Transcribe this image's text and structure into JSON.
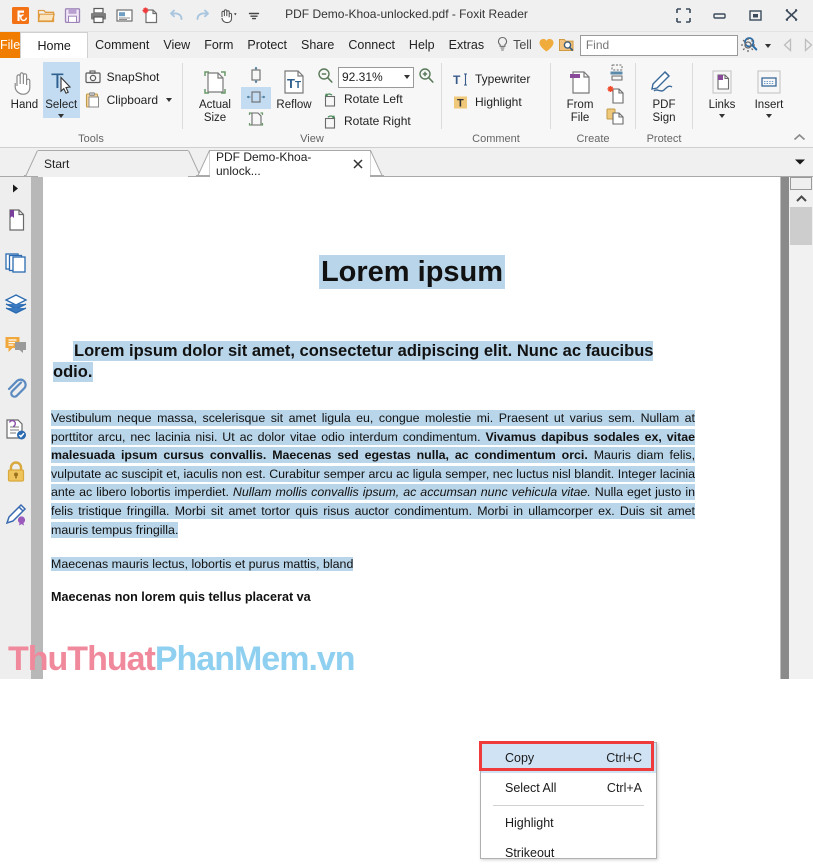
{
  "window": {
    "title": "PDF Demo-Khoa-unlocked.pdf - Foxit Reader",
    "quick_access": [
      {
        "name": "foxit-logo-icon",
        "label": "Foxit"
      },
      {
        "name": "open-icon",
        "label": "Open"
      },
      {
        "name": "save-icon",
        "label": "Save"
      },
      {
        "name": "print-icon",
        "label": "Print"
      },
      {
        "name": "email-icon",
        "label": "Email"
      },
      {
        "name": "new-blank-icon",
        "label": "New"
      },
      {
        "name": "undo-icon",
        "label": "Undo"
      },
      {
        "name": "redo-icon",
        "label": "Redo"
      },
      {
        "name": "hand-tool-icon",
        "label": "Hand Tool"
      },
      {
        "name": "customize-toolbar-icon",
        "label": "Customize"
      }
    ],
    "controls": [
      {
        "name": "fullscreen-icon",
        "label": "Full Screen"
      },
      {
        "name": "minimize-icon",
        "label": "Minimize"
      },
      {
        "name": "maximize-icon",
        "label": "Restore"
      },
      {
        "name": "close-icon",
        "label": "Close"
      }
    ]
  },
  "menubar": {
    "file_label": "File",
    "items": [
      {
        "label": "Home",
        "active": true
      },
      {
        "label": "Comment",
        "active": false
      },
      {
        "label": "View",
        "active": false
      },
      {
        "label": "Form",
        "active": false
      },
      {
        "label": "Protect",
        "active": false
      },
      {
        "label": "Share",
        "active": false
      },
      {
        "label": "Connect",
        "active": false
      },
      {
        "label": "Help",
        "active": false
      },
      {
        "label": "Extras",
        "active": false
      }
    ],
    "tell_label": "Tell",
    "search": {
      "value": "",
      "placeholder": "Find"
    }
  },
  "ribbon": {
    "groups": [
      {
        "name": "Tools",
        "label": "Tools",
        "buttons": [
          {
            "label": "Hand",
            "icon": "hand-icon",
            "active": false
          },
          {
            "label": "Select",
            "icon": "select-text-icon",
            "active": true
          },
          {
            "label": "SnapShot",
            "icon": "snapshot-camera-icon"
          },
          {
            "label": "Clipboard",
            "icon": "clipboard-icon"
          }
        ]
      },
      {
        "name": "View",
        "label": "View",
        "buttons": [
          {
            "label": "Actual Size",
            "icon": "actual-size-icon"
          },
          {
            "label": "Fit Page",
            "icon": "fit-page-icon"
          },
          {
            "label": "Fit Width",
            "icon": "fit-width-icon"
          },
          {
            "label": "Fit Visible",
            "icon": "fit-visible-icon"
          },
          {
            "label": "Reflow",
            "icon": "reflow-icon"
          },
          {
            "label": "Rotate Left",
            "icon": "rotate-left-icon"
          },
          {
            "label": "Rotate Right",
            "icon": "rotate-right-icon"
          }
        ],
        "zoom_value": "92.31%",
        "zoom_out": "zoom-out-icon",
        "zoom_in": "zoom-in-icon"
      },
      {
        "name": "Comment",
        "label": "Comment",
        "buttons": [
          {
            "label": "Typewriter",
            "icon": "typewriter-icon"
          },
          {
            "label": "Highlight",
            "icon": "highlight-icon"
          }
        ]
      },
      {
        "name": "Create",
        "label": "Create",
        "buttons": [
          {
            "label": "From File",
            "icon": "from-file-icon"
          },
          {
            "label": "From Scanner",
            "icon": "from-scanner-icon"
          },
          {
            "label": "Blank",
            "icon": "blank-page-icon"
          },
          {
            "label": "From Clipboard",
            "icon": "from-clipboard-icon"
          }
        ]
      },
      {
        "name": "Protect",
        "label": "Protect",
        "buttons": [
          {
            "label": "PDF Sign",
            "icon": "pdf-sign-icon"
          }
        ]
      },
      {
        "name": "Links",
        "label": "",
        "buttons": [
          {
            "label": "Links",
            "icon": "links-icon"
          },
          {
            "label": "Insert",
            "icon": "insert-icon"
          }
        ]
      }
    ]
  },
  "tabs": [
    {
      "label": "Start",
      "active": false,
      "closable": false
    },
    {
      "label": "PDF Demo-Khoa-unlock...",
      "active": true,
      "closable": true
    }
  ],
  "navpane": {
    "items": [
      {
        "name": "bookmarks-icon",
        "label": "Bookmarks"
      },
      {
        "name": "page-thumbnails-icon",
        "label": "Page Thumbnails"
      },
      {
        "name": "layers-icon",
        "label": "Layers"
      },
      {
        "name": "comments-icon",
        "label": "Comments"
      },
      {
        "name": "attachments-icon",
        "label": "Attachments"
      },
      {
        "name": "digital-signature-panel-icon",
        "label": "Digital Signatures"
      },
      {
        "name": "security-lock-icon",
        "label": "Security Settings"
      },
      {
        "name": "sign-icon",
        "label": "Signature"
      }
    ]
  },
  "document": {
    "heading1": "Lorem ipsum",
    "heading2": "Lorem ipsum dolor sit amet, consectetur adipiscing elit. Nunc ac faucibus odio.",
    "paragraph1": {
      "part1": "Vestibulum neque massa, scelerisque sit amet ligula eu, congue molestie mi. Praesent ut varius sem. Nullam at porttitor arcu, nec lacinia nisi. Ut ac dolor vitae odio interdum condimentum. ",
      "bold1": "Vivamus dapibus sodales ex, vitae malesuada ipsum cursus convallis. Maecenas sed egestas nulla, ac condimentum orci.",
      "part2": " Mauris diam felis, vulputate ac suscipit et, iaculis non est. Curabitur semper arcu ac ligula semper, nec luctus nisl blandit. Integer lacinia ante ac libero lobortis imperdiet. ",
      "italic1": "Nullam mollis convallis ipsum, ac accumsan nunc vehicula vitae.",
      "part3": " Nulla eget justo in felis tristique fringilla. Morbi sit amet tortor quis risus auctor condimentum. Morbi in ullamcorper ex. Duis sit amet mauris tempus fringilla."
    },
    "paragraph2": "Maecenas mauris lectus, lobortis et purus mattis, bland",
    "paragraph3": "Maecenas non lorem quis tellus placerat va"
  },
  "context_menu": {
    "items": [
      {
        "label": "Copy",
        "shortcut": "Ctrl+C",
        "highlighted": true,
        "separator_after": false
      },
      {
        "label": "Select All",
        "shortcut": "Ctrl+A",
        "highlighted": false,
        "separator_after": true
      },
      {
        "label": "Highlight",
        "shortcut": "",
        "highlighted": false,
        "separator_after": false
      },
      {
        "label": "Strikeout",
        "shortcut": "",
        "highlighted": false,
        "separator_after": false
      }
    ]
  },
  "watermark": {
    "part1": "ThuThuat",
    "part2": "PhanMem",
    "part3": ".vn"
  },
  "colors": {
    "file_tab": "#f07d00",
    "selection_highlight": "#b9d5e9",
    "menu_hover": "#cfe3f5",
    "annotation_red": "#ef3b3b",
    "ribbon_active": "#c3dcf2",
    "watermark_pink": "#f0899b",
    "watermark_blue": "#8fd0f0"
  }
}
